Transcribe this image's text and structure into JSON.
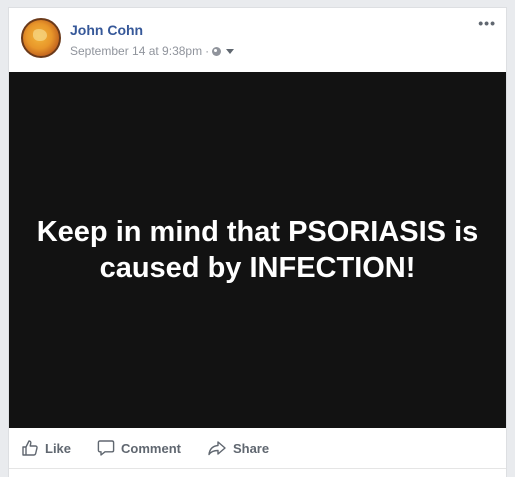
{
  "post": {
    "author": "John Cohn",
    "timestamp": "September 14 at 9:38pm",
    "separator": "·",
    "privacy_icon": "globe-icon",
    "menu_icon": "more-options-icon",
    "more_label": "•••",
    "media_text": "Keep in mind that PSORIASIS is caused by INFECTION!"
  },
  "actions": {
    "like_label": "Like",
    "comment_label": "Comment",
    "share_label": "Share"
  },
  "colors": {
    "author_link": "#365899",
    "meta_text": "#90949c",
    "action_text": "#606770",
    "media_background": "#121212"
  }
}
